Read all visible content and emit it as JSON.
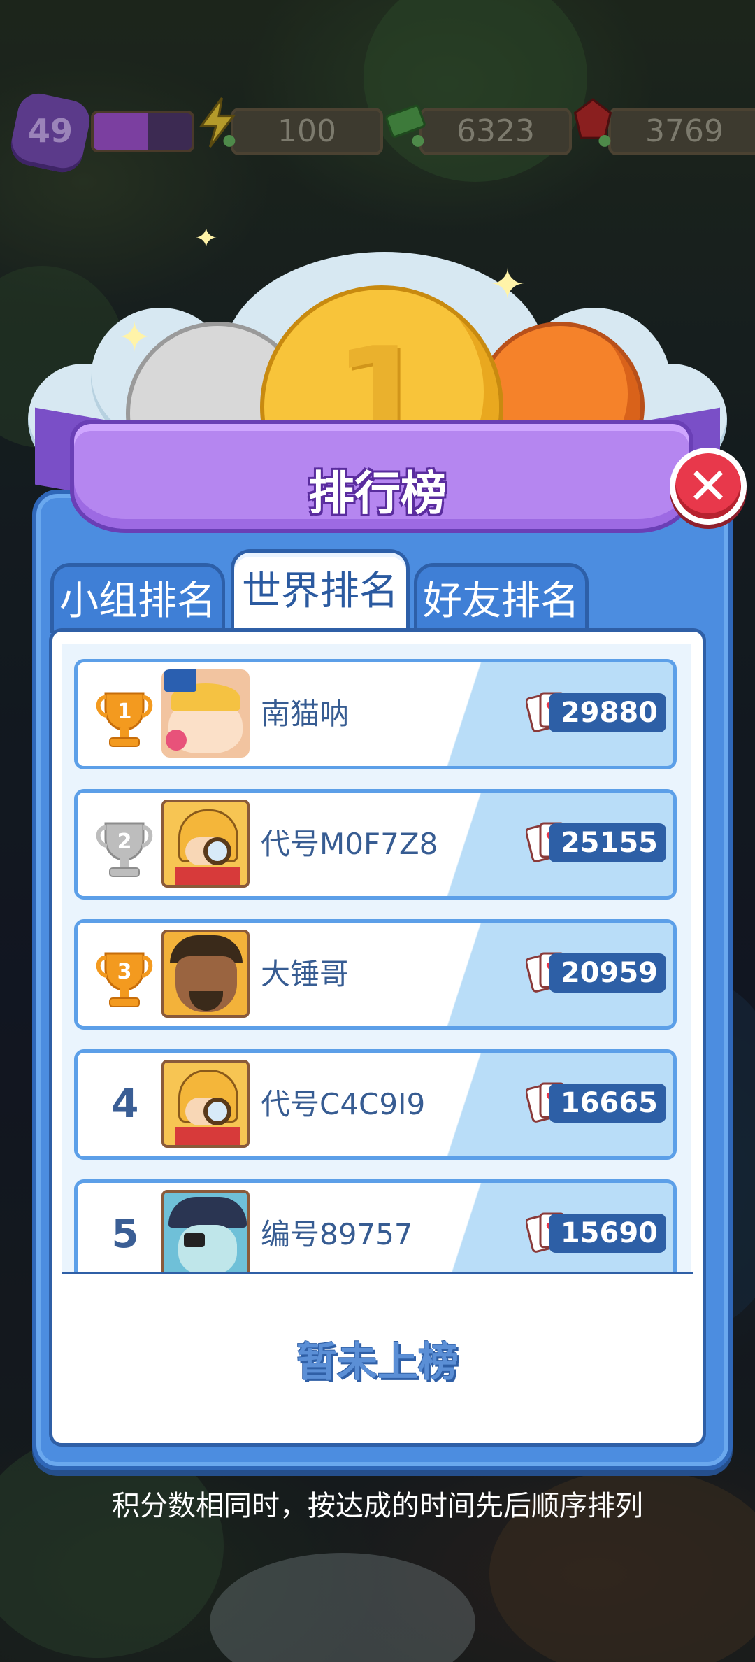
{
  "hud": {
    "level": "49",
    "xp_fraction": 0.55,
    "energy": "100",
    "cash": "6323",
    "gems": "3769"
  },
  "leaderboard": {
    "title": "排行榜",
    "tabs": [
      {
        "label": "小组排名",
        "active": false
      },
      {
        "label": "世界排名",
        "active": true
      },
      {
        "label": "好友排名",
        "active": false
      }
    ],
    "rows": [
      {
        "rank": "1",
        "name": "南猫呐",
        "score": "29880",
        "trophy": "gold"
      },
      {
        "rank": "2",
        "name": "代号M0F7Z8",
        "score": "25155",
        "trophy": "silver"
      },
      {
        "rank": "3",
        "name": "大锤哥",
        "score": "20959",
        "trophy": "bronze"
      },
      {
        "rank": "4",
        "name": "代号C4C9I9",
        "score": "16665",
        "trophy": ""
      },
      {
        "rank": "5",
        "name": "编号89757",
        "score": "15690",
        "trophy": ""
      }
    ],
    "my_rank": "暂未上榜",
    "footnote": "积分数相同时，按达成的时间先后顺序排列"
  },
  "colors": {
    "panel": "#4c8de0",
    "ribbon": "#b586f0",
    "gold": "#f8c43a",
    "silver": "#d9d9d9",
    "bronze": "#f5822a",
    "close": "#e8384b"
  }
}
